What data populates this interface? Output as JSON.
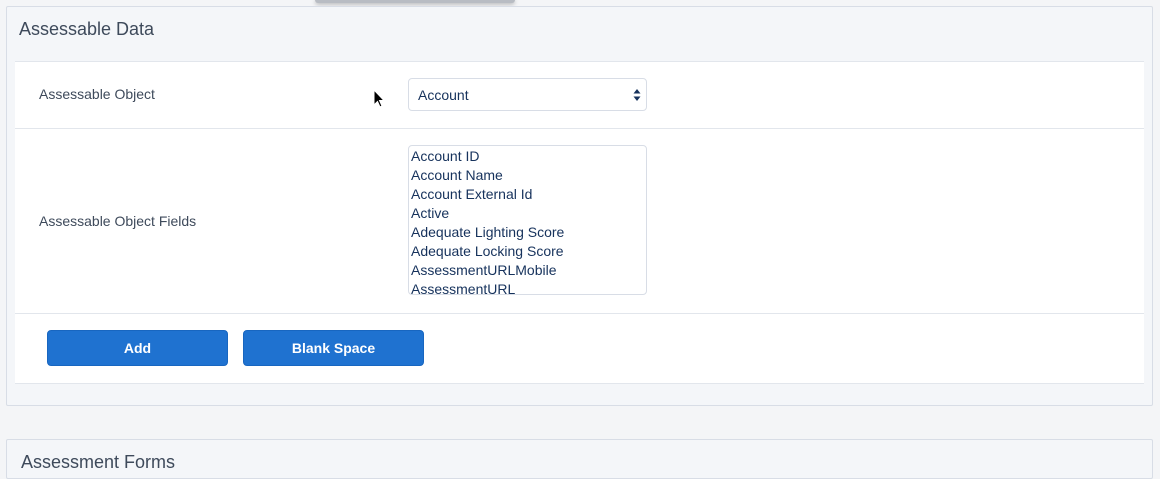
{
  "section": {
    "title": "Assessable Data"
  },
  "assessable_object": {
    "label": "Assessable Object",
    "selected": "Account"
  },
  "assessable_fields": {
    "label": "Assessable Object Fields",
    "options": [
      "Account ID",
      "Account Name",
      "Account External Id",
      "Active",
      "Adequate Lighting Score",
      "Adequate Locking Score",
      "AssessmentURLMobile",
      "AssessmentURL"
    ]
  },
  "buttons": {
    "add_label": "Add",
    "blank_space_label": "Blank Space"
  },
  "next_section": {
    "title": "Assessment Forms"
  },
  "colors": {
    "primary_button": "#1f72d0",
    "panel_background": "#f4f6f9",
    "text": "#16325c"
  }
}
